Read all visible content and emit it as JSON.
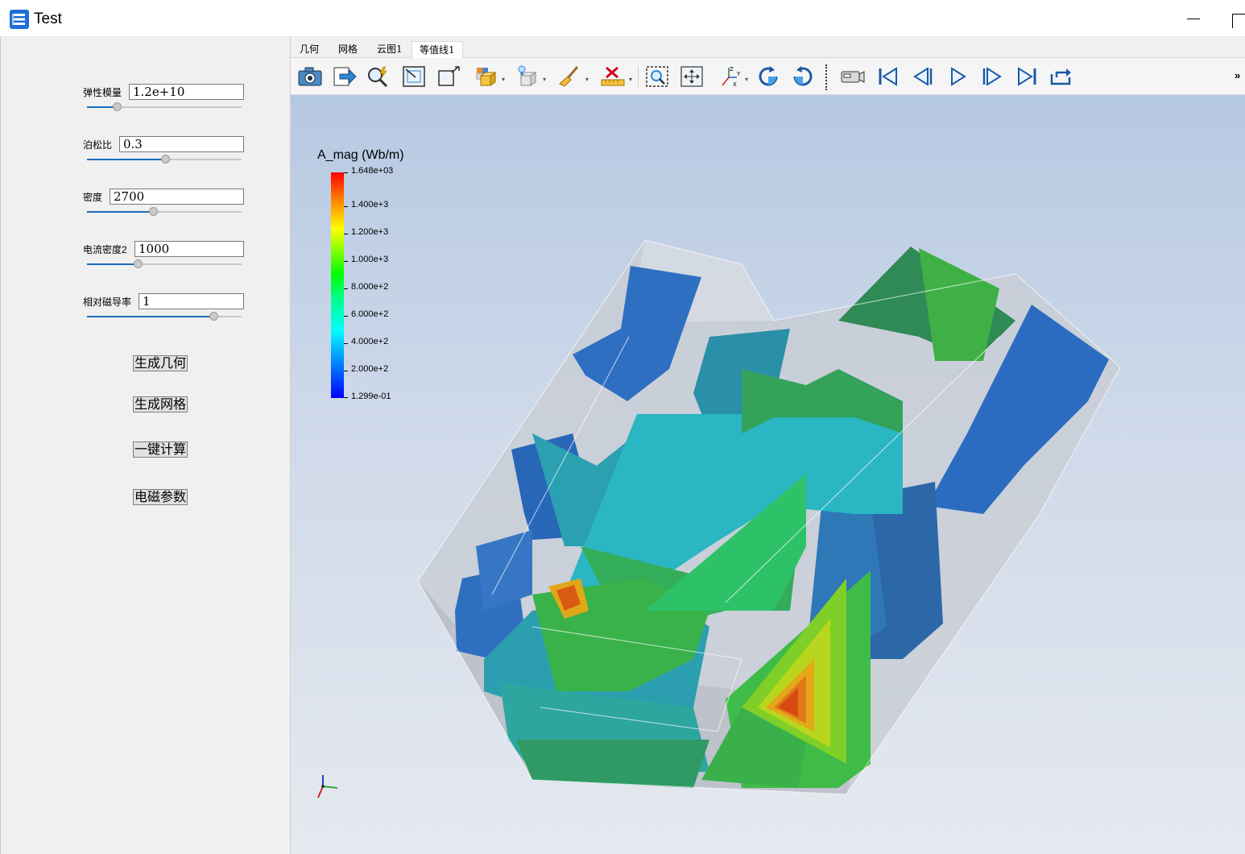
{
  "window": {
    "title": "Test",
    "icon": "app-stack-icon"
  },
  "params": [
    {
      "label": "弹性模量",
      "value": "1.2e+10",
      "slider": 0.19
    },
    {
      "label": "泊松比",
      "value": "0.3",
      "slider": 0.5
    },
    {
      "label": "密度",
      "value": "2700",
      "slider": 0.43
    },
    {
      "label": "电流密度2",
      "value": "1000",
      "slider": 0.33
    },
    {
      "label": "相对磁导率",
      "value": "1",
      "slider": 0.82
    }
  ],
  "actions": [
    {
      "label": "生成几何"
    },
    {
      "label": "生成网格"
    },
    {
      "label": "一键计算"
    },
    {
      "label": "电磁参数"
    }
  ],
  "tabs": [
    {
      "label": "几何",
      "active": false
    },
    {
      "label": "网格",
      "active": false
    },
    {
      "label": "云图1",
      "active": false
    },
    {
      "label": "等值线1",
      "active": true
    }
  ],
  "toolbar": {
    "icons": [
      "camera-icon",
      "export-icon",
      "zoom-to-data-icon",
      "reset-view-icon",
      "box-view-icon",
      "color-map-icon",
      "surface-style-icon",
      "clear-brush-icon",
      "delete-ruler-icon",
      "zoom-box-icon",
      "pan-icon",
      "axes-orientation-icon",
      "rotate-cw-icon",
      "rotate-ccw-icon",
      "camera-record-icon",
      "first-frame-icon",
      "prev-frame-icon",
      "play-icon",
      "next-frame-icon",
      "last-frame-icon",
      "loop-icon"
    ],
    "more_label": "»"
  },
  "colorbar": {
    "title": "A_mag (Wb/m)",
    "labels": [
      "1.648e+03",
      "1.400e+3",
      "1.200e+3",
      "1.000e+3",
      "8.000e+2",
      "6.000e+2",
      "4.000e+2",
      "2.000e+2",
      "1.299e-01"
    ],
    "colors": [
      "#0000ff",
      "#00ffff",
      "#00ff00",
      "#ffff00",
      "#ff0000"
    ]
  },
  "axes_triad": {
    "x": "x-axis-red",
    "y": "y-axis-green",
    "z": "z-axis-blue"
  }
}
